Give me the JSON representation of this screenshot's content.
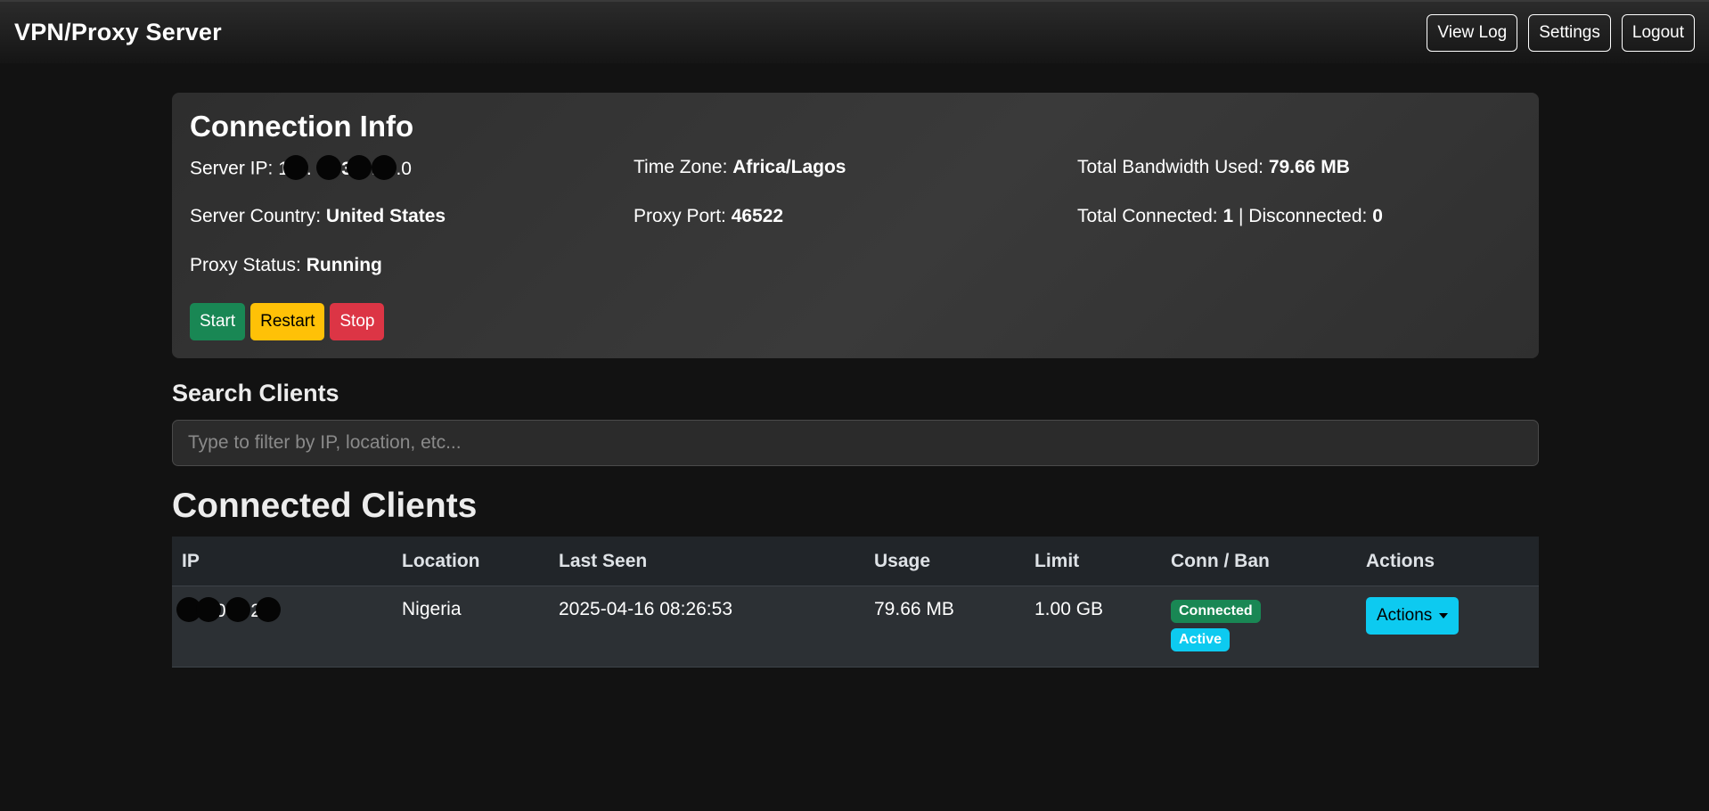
{
  "navbar": {
    "brand": "VPN/Proxy Server",
    "buttons": [
      "View Log",
      "Settings",
      "Logout"
    ]
  },
  "connection_info": {
    "title": "Connection Info",
    "server_ip_label": "Server IP:",
    "server_ip_visible": "1 .  3  .  .  0",
    "time_zone_label": "Time Zone:",
    "time_zone": "Africa/Lagos",
    "bandwidth_label": "Total Bandwidth Used:",
    "bandwidth": "79.66 MB",
    "server_country_label": "Server Country:",
    "server_country": "United States",
    "proxy_port_label": "Proxy Port:",
    "proxy_port": "46522",
    "total_connected_label": "Total Connected:",
    "total_connected": "1",
    "separator": "|",
    "disconnected_label": "Disconnected:",
    "disconnected": "0",
    "proxy_status_label": "Proxy Status:",
    "proxy_status": "Running",
    "buttons": {
      "start": "Start",
      "restart": "Restart",
      "stop": "Stop"
    }
  },
  "search": {
    "label": "Search Clients",
    "placeholder": "Type to filter by IP, location, etc..."
  },
  "clients": {
    "title": "Connected Clients",
    "columns": [
      "IP",
      "Location",
      "Last Seen",
      "Usage",
      "Limit",
      "Conn / Ban",
      "Actions"
    ],
    "rows": [
      {
        "ip_visible": "0. 2",
        "location": "Nigeria",
        "last_seen": "2025-04-16 08:26:53",
        "usage": "79.66 MB",
        "limit": "1.00 GB",
        "conn_badge": "Connected",
        "ban_badge": "Active",
        "actions_label": "Actions"
      }
    ]
  },
  "colors": {
    "background": "#121212",
    "success": "#198754",
    "warning": "#ffc107",
    "danger": "#dc3545",
    "info": "#0dcaf0"
  }
}
